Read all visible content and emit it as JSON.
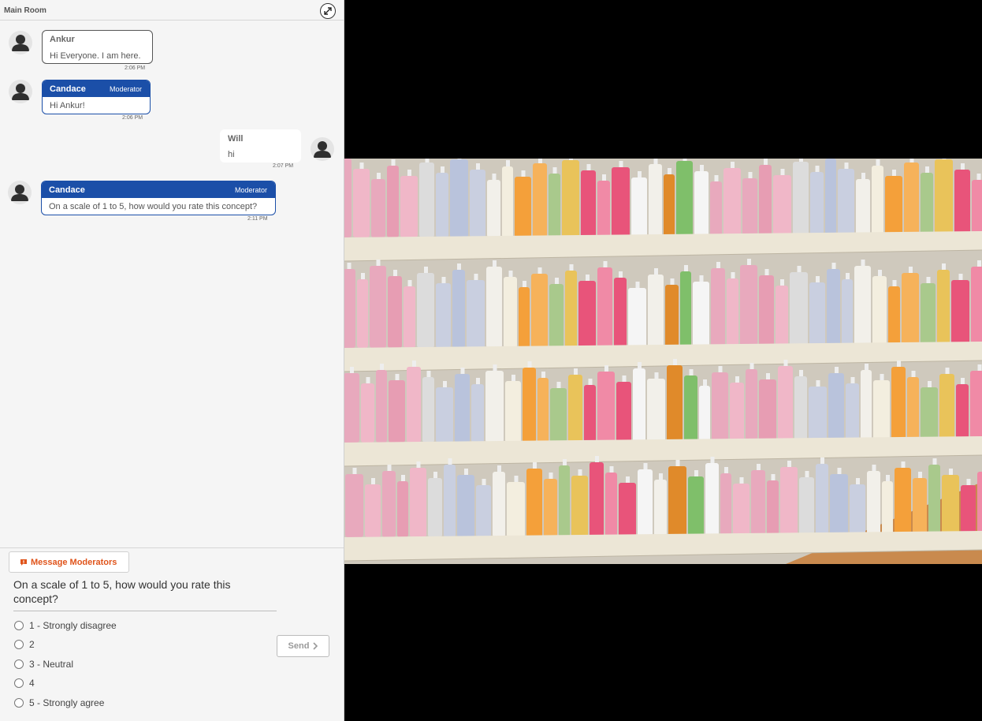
{
  "room": {
    "title": "Main Room",
    "expand_icon": "expand-arrows-icon"
  },
  "messages": [
    {
      "sender": "Ankur",
      "text": "Hi Everyone. I am here.",
      "time": "2:06 PM",
      "role": ""
    },
    {
      "sender": "Candace",
      "text": "Hi Ankur!",
      "time": "2:06 PM",
      "role": "Moderator"
    },
    {
      "sender": "Will",
      "text": "hi",
      "time": "2:07 PM",
      "role": ""
    },
    {
      "sender": "Candace",
      "text": "On a scale of 1 to 5, how would you rate this concept?",
      "time": "2:11 PM",
      "role": "Moderator"
    }
  ],
  "question": {
    "message_moderators_label": "Message Moderators",
    "text": "On a scale of 1 to 5, how would you rate this concept?",
    "options": [
      "1 - Strongly disagree",
      "2",
      "3 - Neutral",
      "4",
      "5 - Strongly agree"
    ],
    "send_label": "Send"
  },
  "colors": {
    "moderator_blue": "#1b4fa8",
    "accent_orange": "#e0541b",
    "panel_bg": "#f5f5f5"
  }
}
